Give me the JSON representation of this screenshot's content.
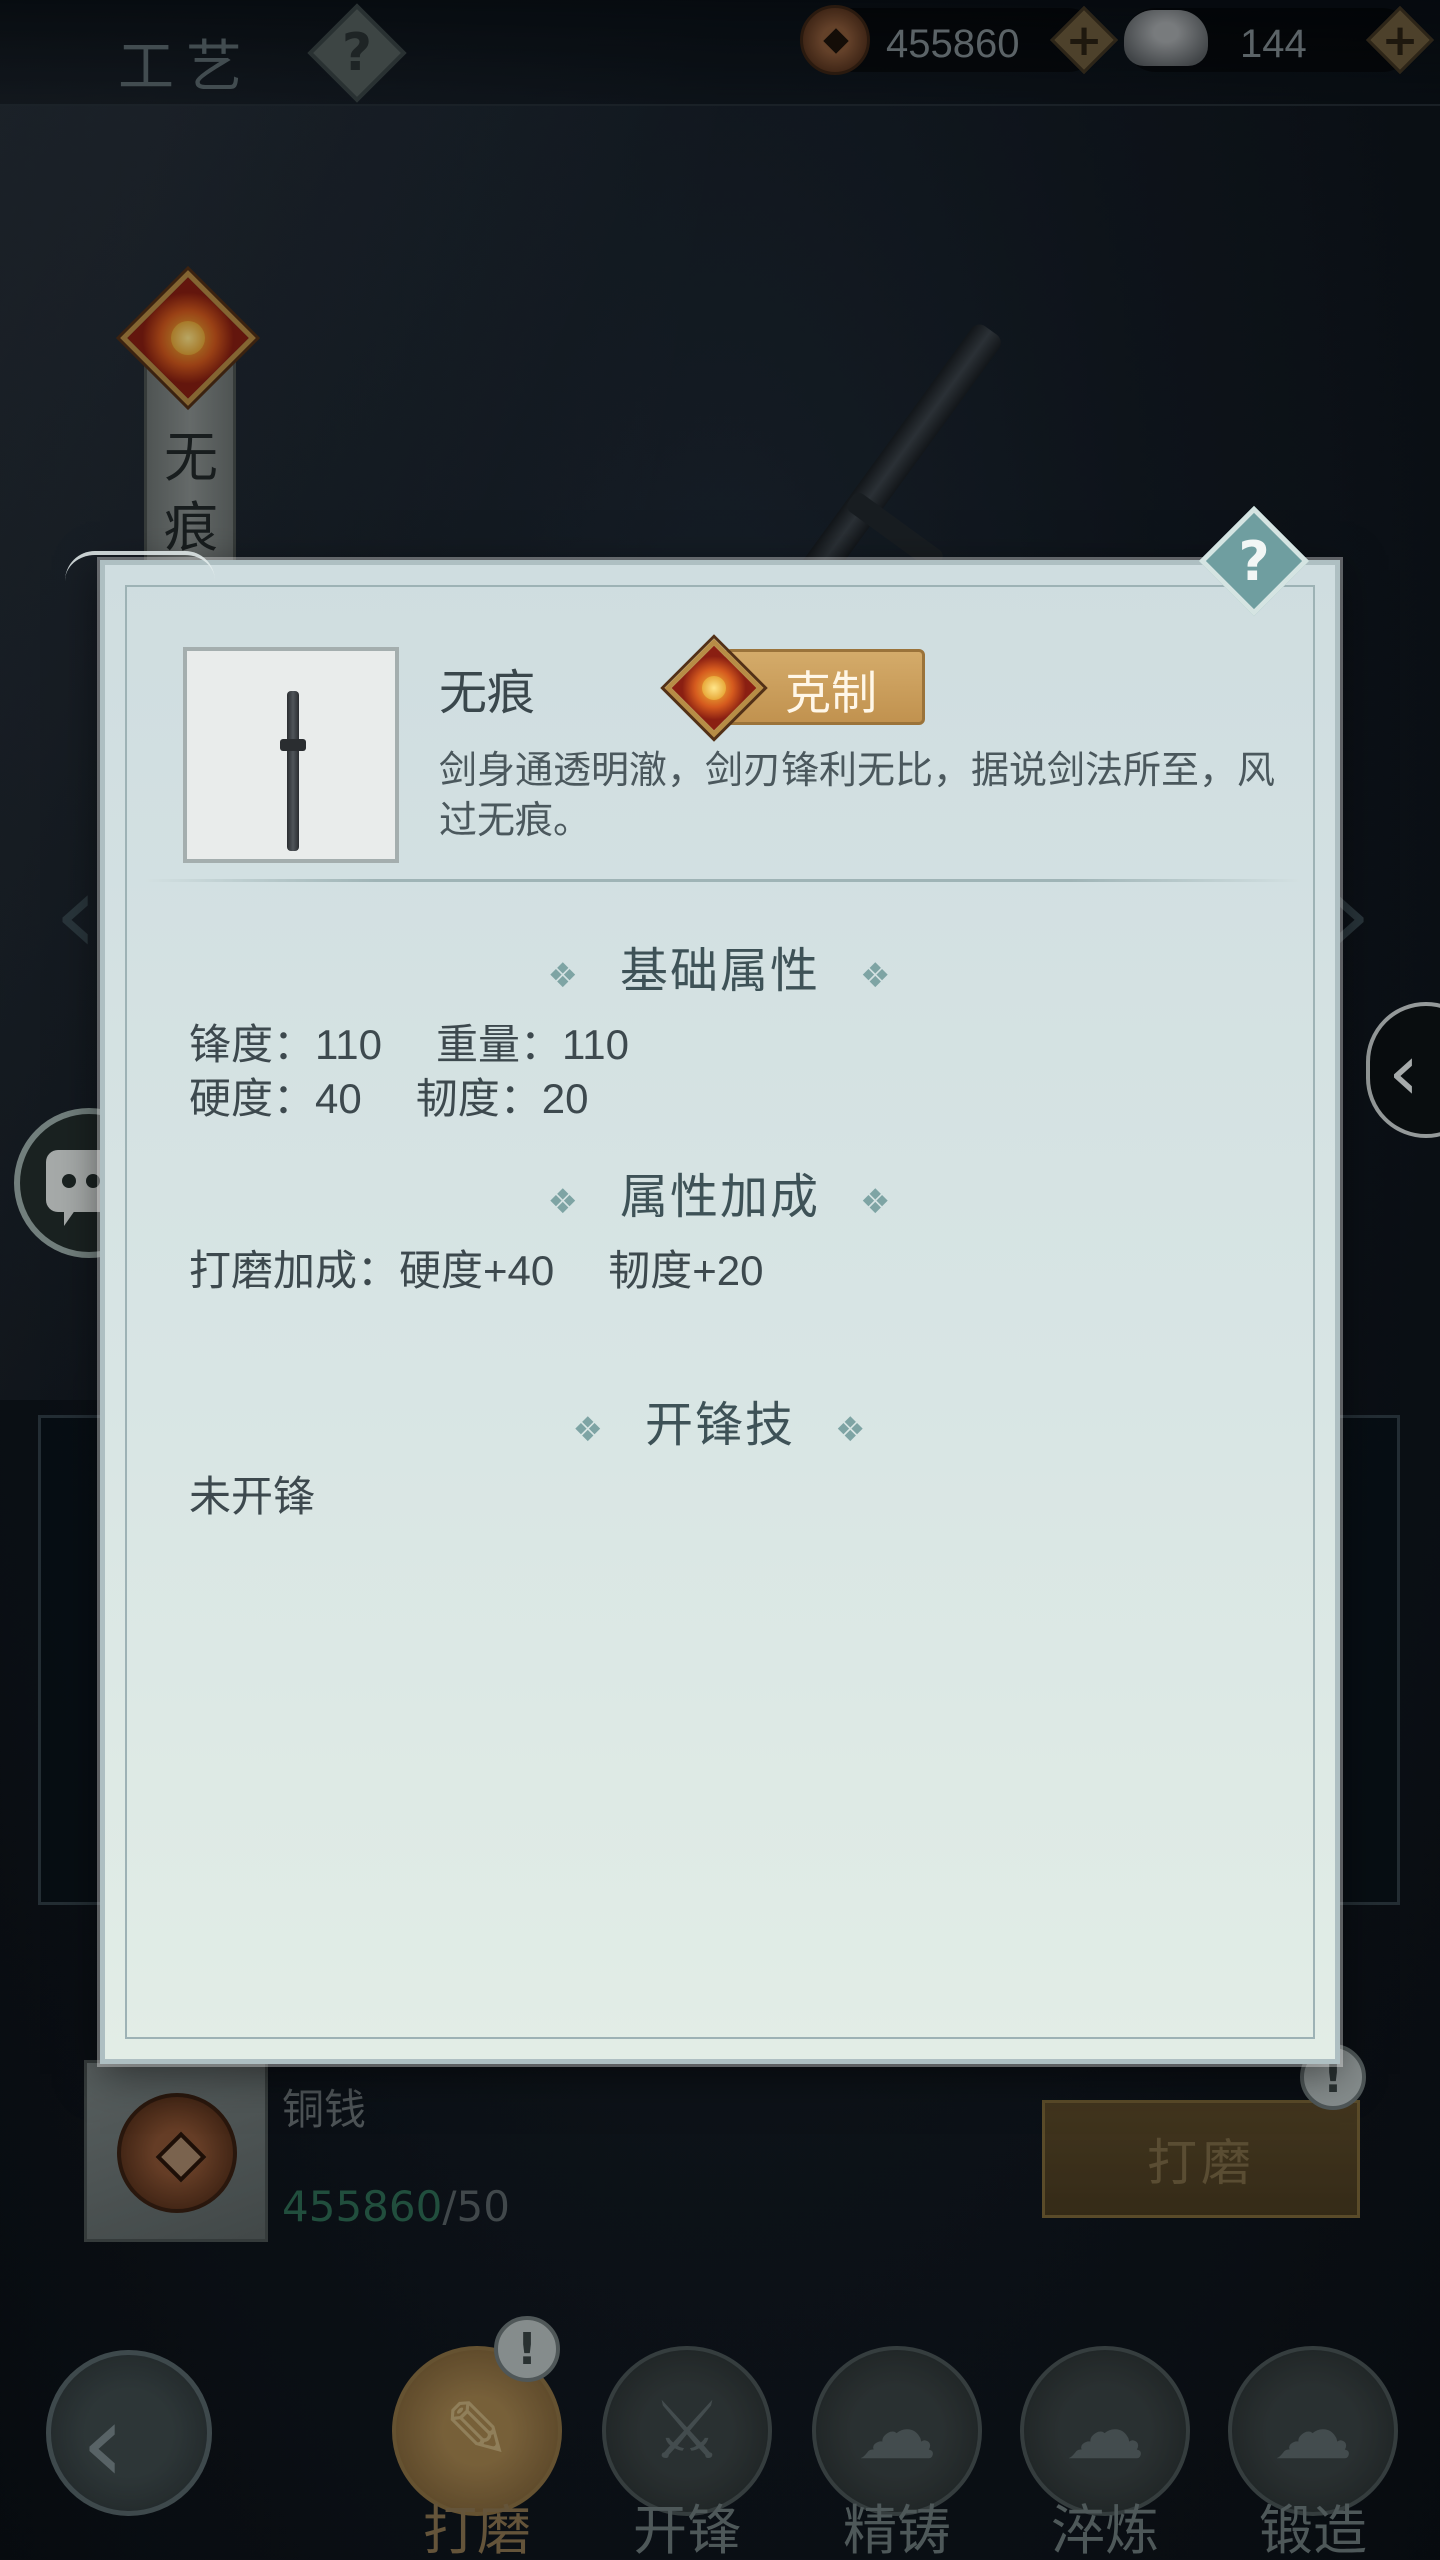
{
  "topbar": {
    "title": "工艺",
    "help_glyph": "?",
    "copper_value": "455860",
    "silver_value": "144",
    "plus_glyph": "+"
  },
  "weapon_tag": {
    "name": "无痕"
  },
  "background": {
    "cost_label": "铜钱",
    "cost_have": "455860",
    "cost_need": "/50",
    "action_button": "打磨",
    "alert_glyph": "!"
  },
  "nav": {
    "back_glyph": "‹",
    "items": [
      {
        "label": "打磨",
        "glyph": "✎"
      },
      {
        "label": "开锋",
        "glyph": "⚔"
      },
      {
        "label": "精铸",
        "glyph": "☁"
      },
      {
        "label": "淬炼",
        "glyph": "☁"
      },
      {
        "label": "锻造",
        "glyph": "☁"
      }
    ]
  },
  "side": {
    "left_arrow": "‹",
    "right_arrow": "›",
    "collapse_glyph": "‹"
  },
  "modal": {
    "help_glyph": "?",
    "item_name": "无痕",
    "type_badge": "克制",
    "description": "剑身通透明澈，剑刃锋利无比，据说剑法所至，风过无痕。",
    "sections": {
      "base_title": "基础属性",
      "bonus_title": "属性加成",
      "skill_title": "开锋技",
      "ornament": "❖"
    },
    "base_attrs": {
      "sharpness": "锋度：110",
      "weight": "重量：110",
      "hardness": "硬度：40",
      "toughness": "韧度：20"
    },
    "bonus": {
      "label": "打磨加成：",
      "hardness": "硬度+40",
      "toughness": "韧度+20"
    },
    "skill_status": "未开锋"
  },
  "colors": {
    "modal_bg": "#d8e5e4",
    "accent_gold": "#c9a060",
    "accent_teal": "#6f9ea0",
    "cost_have_green": "#2e6d55"
  }
}
